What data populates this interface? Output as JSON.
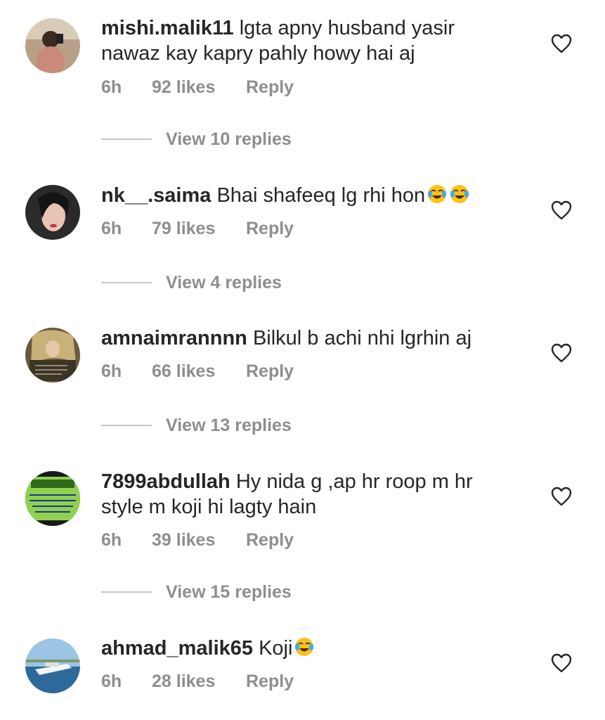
{
  "comments": [
    {
      "username": "mishi.malik11",
      "text": "lgta apny husband yasir nawaz kay kapry pahly howy hai aj",
      "time": "6h",
      "likes": "92 likes",
      "reply": "Reply",
      "view_replies": "View 10 replies",
      "emoji_count": 0
    },
    {
      "username": "nk__.saima",
      "text": "Bhai shafeeq lg rhi hon",
      "time": "6h",
      "likes": "79 likes",
      "reply": "Reply",
      "view_replies": "View 4 replies",
      "emoji_count": 2
    },
    {
      "username": "amnaimrannnn",
      "text": "Bilkul b achi nhi lgrhin aj",
      "time": "6h",
      "likes": "66 likes",
      "reply": "Reply",
      "view_replies": "View 13 replies",
      "emoji_count": 0
    },
    {
      "username": "7899abdullah",
      "text": "Hy nida g ,ap hr roop m hr style m koji hi lagty hain",
      "time": "6h",
      "likes": "39 likes",
      "reply": "Reply",
      "view_replies": "View 15 replies",
      "emoji_count": 0
    },
    {
      "username": "ahmad_malik65",
      "text": "Koji",
      "time": "6h",
      "likes": "28 likes",
      "reply": "Reply",
      "emoji_count": 1
    }
  ],
  "icons": {
    "like": "heart-outline-icon",
    "emoji": "face-with-tears-of-joy-emoji"
  },
  "colors": {
    "text": "#262626",
    "secondary": "#8e8e8e",
    "divider": "#c7c7c7"
  }
}
